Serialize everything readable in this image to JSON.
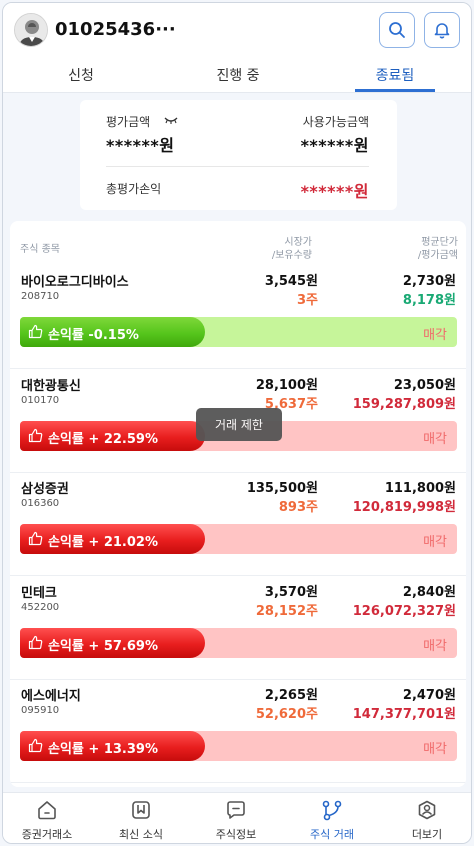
{
  "header": {
    "user_name": "01025436···"
  },
  "tabs": [
    {
      "label": "신청",
      "active": false
    },
    {
      "label": "진행 중",
      "active": false
    },
    {
      "label": "종료됨",
      "active": true
    }
  ],
  "summary": {
    "eval_amount_label": "평가금액",
    "eval_amount_value": "******원",
    "available_label": "사용가능금액",
    "available_value": "******원",
    "total_pnl_label": "총평가손익",
    "total_pnl_value": "******원"
  },
  "list": {
    "col_stock": "주식 종목",
    "col_price_1": "시장가",
    "col_price_2": "/보유수량",
    "col_avg_1": "평균단가",
    "col_avg_2": "/평가금액",
    "rows": [
      {
        "name": "바이오로그디바이스",
        "code": "208710",
        "price": "3,545원",
        "qty": "3주",
        "avg": "2,730원",
        "eval": "8,178원",
        "pnl": "손익률 -0.15%",
        "sell": "매각",
        "tone": "green"
      },
      {
        "name": "대한광통신",
        "code": "010170",
        "price": "28,100원",
        "qty": "5,637주",
        "avg": "23,050원",
        "eval": "159,287,809원",
        "pnl": "손익률 + 22.59%",
        "sell": "매각",
        "tone": "red"
      },
      {
        "name": "삼성증권",
        "code": "016360",
        "price": "135,500원",
        "qty": "893주",
        "avg": "111,800원",
        "eval": "120,819,998원",
        "pnl": "손익률 + 21.02%",
        "sell": "매각",
        "tone": "red"
      },
      {
        "name": "민테크",
        "code": "452200",
        "price": "3,570원",
        "qty": "28,152주",
        "avg": "2,840원",
        "eval": "126,072,327원",
        "pnl": "손익률 + 57.69%",
        "sell": "매각",
        "tone": "red"
      },
      {
        "name": "에스에너지",
        "code": "095910",
        "price": "2,265원",
        "qty": "52,620주",
        "avg": "2,470원",
        "eval": "147,377,701원",
        "pnl": "손익률 + 13.39%",
        "sell": "매각",
        "tone": "red"
      }
    ]
  },
  "tooltip": "거래 제한",
  "bottom_nav": [
    {
      "label": "증권거래소",
      "icon": "home-icon",
      "active": false
    },
    {
      "label": "최신 소식",
      "icon": "bookmark-icon",
      "active": false
    },
    {
      "label": "주식정보",
      "icon": "chat-icon",
      "active": false
    },
    {
      "label": "주식 거래",
      "icon": "share-icon",
      "active": true
    },
    {
      "label": "더보기",
      "icon": "profile-icon",
      "active": false
    }
  ],
  "colors": {
    "accent": "#2566c8",
    "loss_red": "#d12a3a",
    "qty_orange": "#ef6a3a",
    "gain_green": "#19a974"
  }
}
